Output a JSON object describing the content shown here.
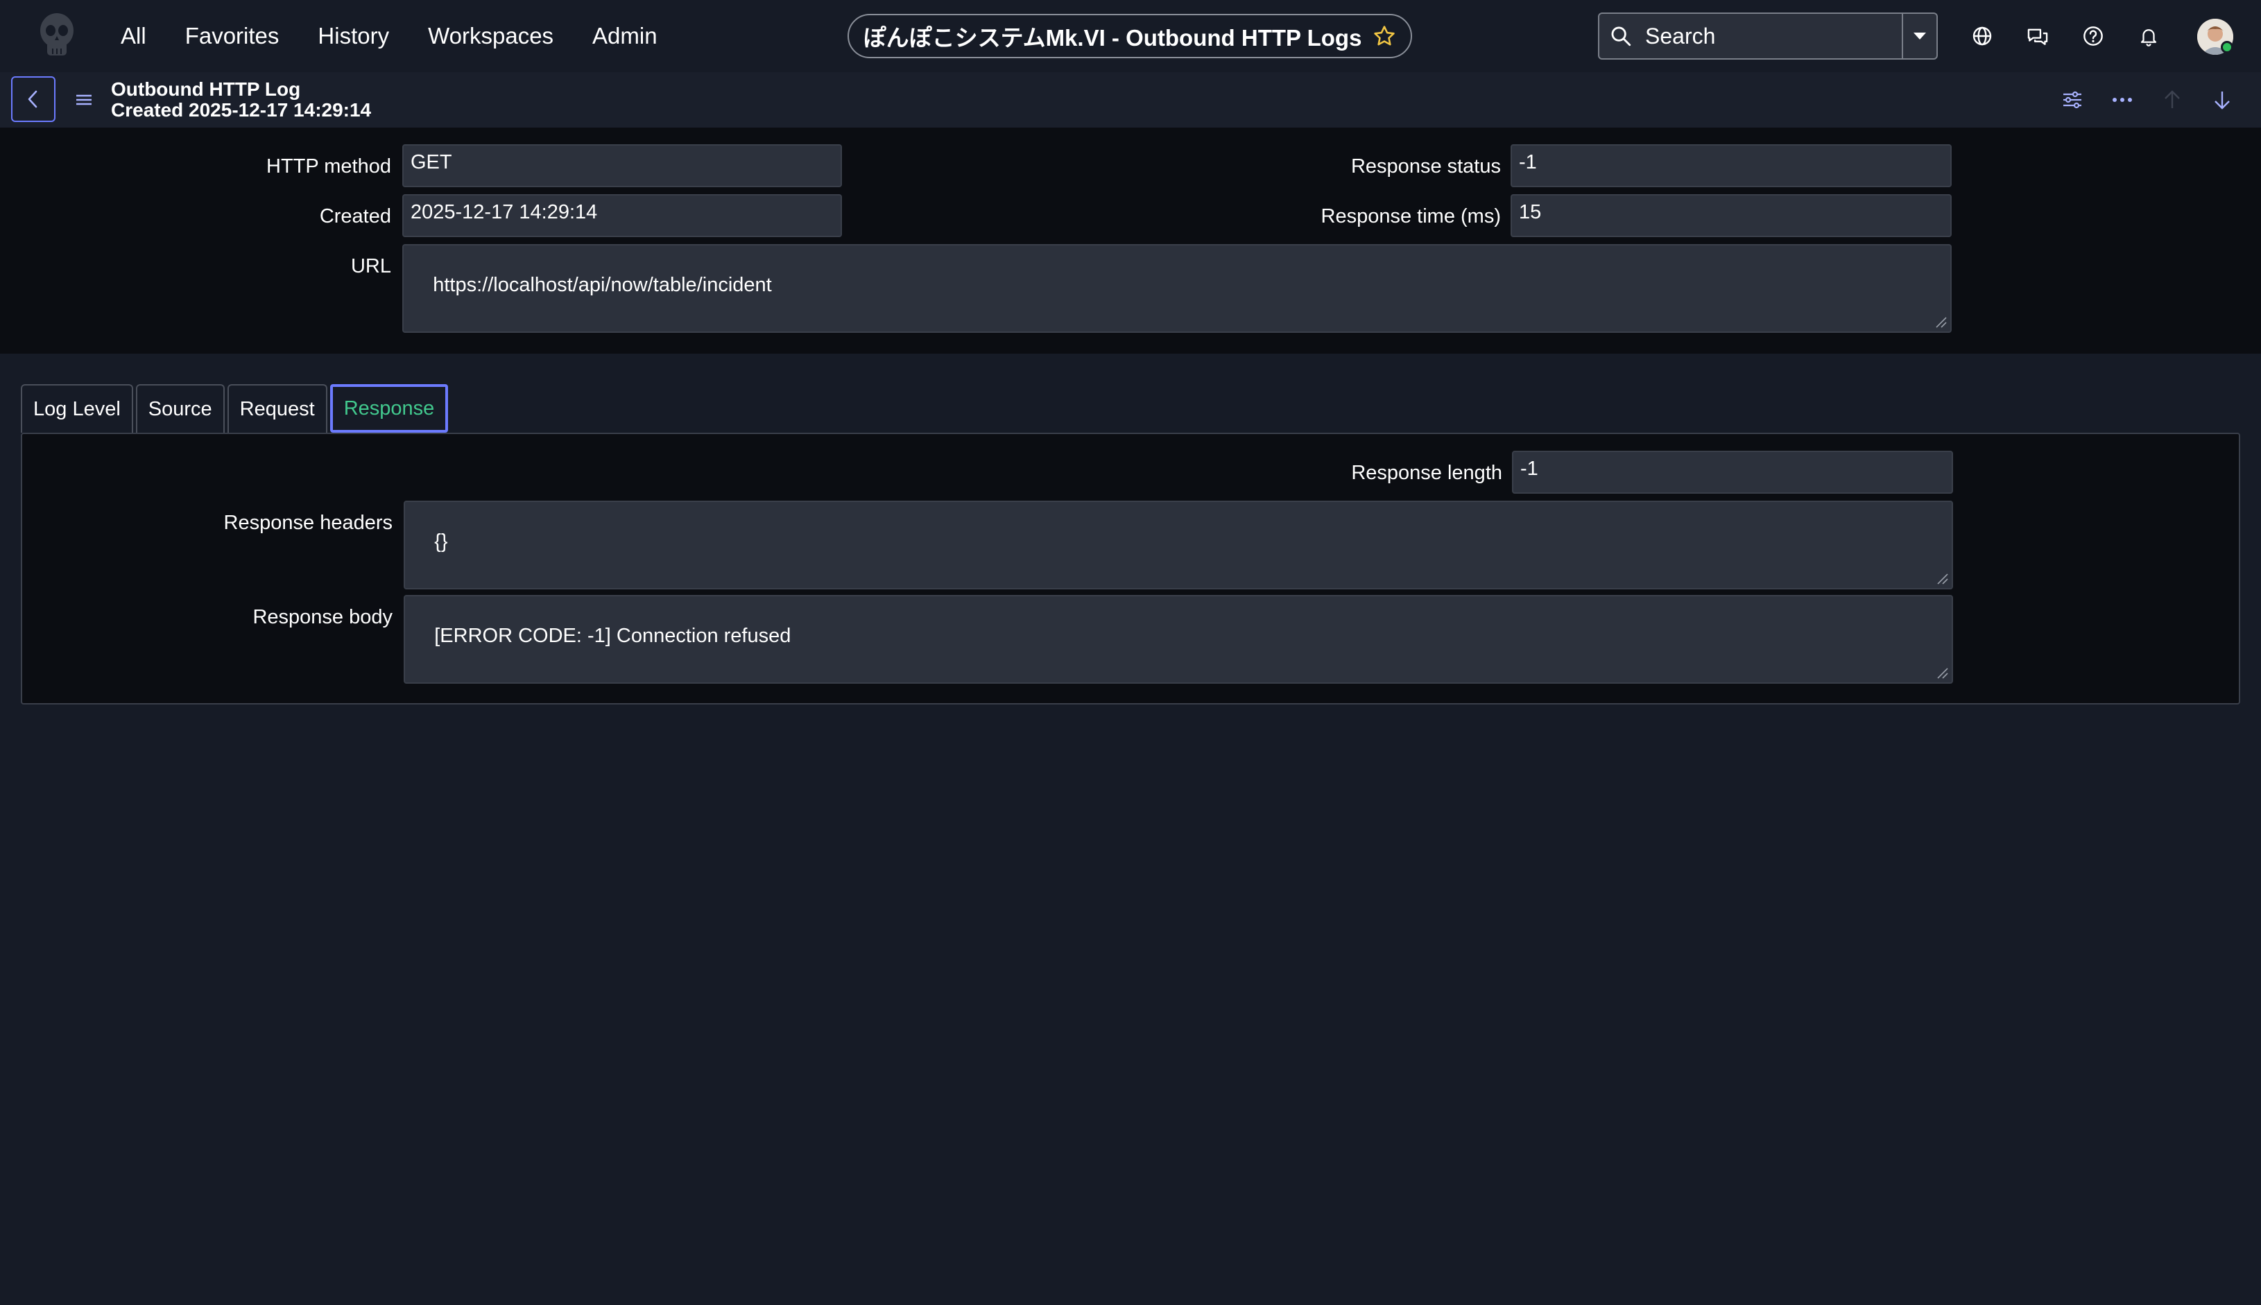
{
  "nav": {
    "items": [
      "All",
      "Favorites",
      "History",
      "Workspaces",
      "Admin"
    ],
    "title": "ぽんぽこシステムMk.VI - Outbound HTTP Logs",
    "search_label": "Search"
  },
  "header": {
    "record_type": "Outbound HTTP Log",
    "created_line": "Created 2025-12-17 14:29:14"
  },
  "fields": {
    "http_method": {
      "label": "HTTP method",
      "value": "GET"
    },
    "created": {
      "label": "Created",
      "value": "2025-12-17 14:29:14"
    },
    "url": {
      "label": "URL",
      "value": "https://localhost/api/now/table/incident"
    },
    "response_status": {
      "label": "Response status",
      "value": "-1"
    },
    "response_time": {
      "label": "Response time (ms)",
      "value": "15"
    }
  },
  "tabs": {
    "log_level": "Log Level",
    "source": "Source",
    "request": "Request",
    "response": "Response",
    "active": "Response"
  },
  "response_tab": {
    "response_length": {
      "label": "Response length",
      "value": "-1"
    },
    "response_headers": {
      "label": "Response headers",
      "value": "{}"
    },
    "response_body": {
      "label": "Response body",
      "value": "[ERROR CODE: -1] Connection refused"
    }
  },
  "colors": {
    "background": "#161b26",
    "form_background": "#0b0d12",
    "input_background": "#2c313c",
    "accent": "#6c7bff",
    "active_tab_text": "#42c98e",
    "presence": "#2fbf5b"
  },
  "icons": {
    "logo": "skull-logo-icon",
    "favorite": "star-icon",
    "search": "search-icon",
    "dropdown": "caret-down-icon",
    "globe": "globe-icon",
    "chat": "chat-icon",
    "help": "help-icon",
    "notifications": "bell-icon",
    "back": "chevron-left-icon",
    "menu": "hamburger-icon",
    "settings": "sliders-icon",
    "more": "more-icon",
    "prev": "arrow-up-icon",
    "next": "arrow-down-icon"
  }
}
